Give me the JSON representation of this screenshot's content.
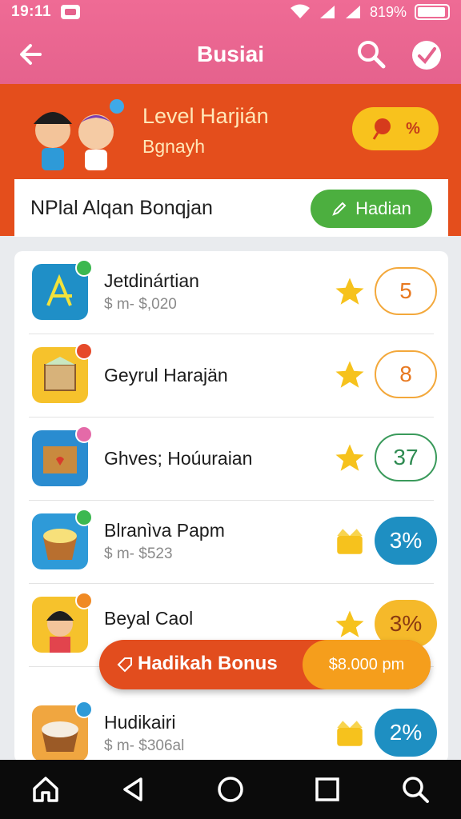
{
  "status": {
    "time": "19:11",
    "battery_text": "819%"
  },
  "appbar": {
    "title": "Busiai"
  },
  "level": {
    "title": "Level Harjián",
    "subtitle": "Bgnayh",
    "badge_text": "%"
  },
  "claim": {
    "text": "NPlal Alqan Bonqjan",
    "button_label": "Hadian"
  },
  "items": [
    {
      "name": "Jetdinártian",
      "sub": "$ m- $,020",
      "score": "5",
      "style": "outline-orange",
      "star": "star-icon",
      "icon_color": "#1f8fc7"
    },
    {
      "name": "Geyrul Harajän",
      "sub": "",
      "score": "8",
      "style": "outline-orange",
      "star": "star-icon",
      "icon_color": "#f6c22c"
    },
    {
      "name": "Ghves; Hoúuraian",
      "sub": "",
      "score": "37",
      "style": "outline-green",
      "star": "star-icon",
      "icon_color": "#2a8cd0"
    },
    {
      "name": "Blranìva Papm",
      "sub": "$ m- $523",
      "score": "3%",
      "style": "filled-blue",
      "star": "gift-icon",
      "icon_color": "#2e9ad8"
    },
    {
      "name": "Beyal Caol",
      "sub": "",
      "score": "3%",
      "style": "filled-yellow",
      "star": "star-icon",
      "icon_color": "#f6c22c"
    },
    {
      "name": "Hudikairi",
      "sub": "$ m- $306al",
      "score": "2%",
      "style": "filled-blue",
      "star": "gift-icon",
      "icon_color": "#f0a640"
    }
  ],
  "bonus": {
    "label": "Hadikah Bonus",
    "amount": "$8.000 pm"
  },
  "colors": {
    "accent": "#e44e1c",
    "pink": "#ef6b95",
    "green": "#4caf3f",
    "blue": "#1e8fc2",
    "yellow": "#f5b92a"
  }
}
